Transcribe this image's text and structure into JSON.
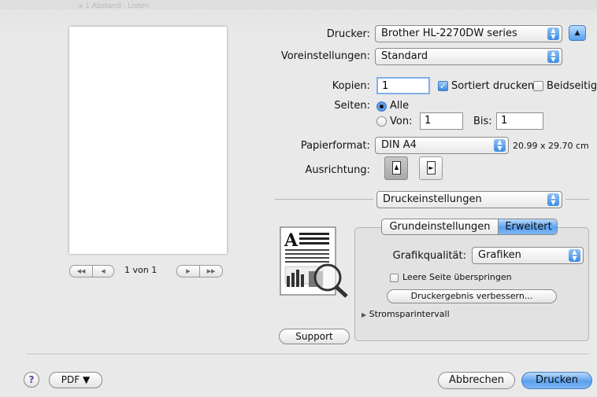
{
  "background_hint": "x 1 Abstand · Listen",
  "printer": {
    "label": "Drucker:",
    "value": "Brother HL-2270DW series"
  },
  "presets": {
    "label": "Voreinstellungen:",
    "value": "Standard"
  },
  "copies": {
    "label": "Kopien:",
    "value": "1",
    "collate_label": "Sortiert drucken",
    "collate_checked": true,
    "duplex_label": "Beidseitig",
    "duplex_checked": false
  },
  "pages": {
    "label": "Seiten:",
    "all_label": "Alle",
    "from_label": "Von:",
    "from_value": "1",
    "to_label": "Bis:",
    "to_value": "1"
  },
  "paper": {
    "label": "Papierformat:",
    "value": "DIN A4",
    "size_text": "20.99 x 29.70 cm"
  },
  "orientation": {
    "label": "Ausrichtung:"
  },
  "section_popup": {
    "value": "Druckeinstellungen"
  },
  "tabs": [
    {
      "label": "Grundeinstellungen",
      "selected": false
    },
    {
      "label": "Erweitert",
      "selected": true
    }
  ],
  "advanced": {
    "graphics_label": "Grafikqualität:",
    "graphics_value": "Grafiken",
    "skip_blank_label": "Leere Seite überspringen",
    "skip_blank_checked": false,
    "improve_button": "Druckergebnis verbessern...",
    "sleep_label": "Stromsparintervall"
  },
  "preview": {
    "page_label": "1 von 1"
  },
  "support_button": "Support",
  "bottom": {
    "help": "?",
    "pdf": "PDF ▼",
    "cancel": "Abbrechen",
    "print": "Drucken"
  },
  "colors": {
    "accent": "#3d88e0",
    "window_bg": "#e9e9e9"
  }
}
